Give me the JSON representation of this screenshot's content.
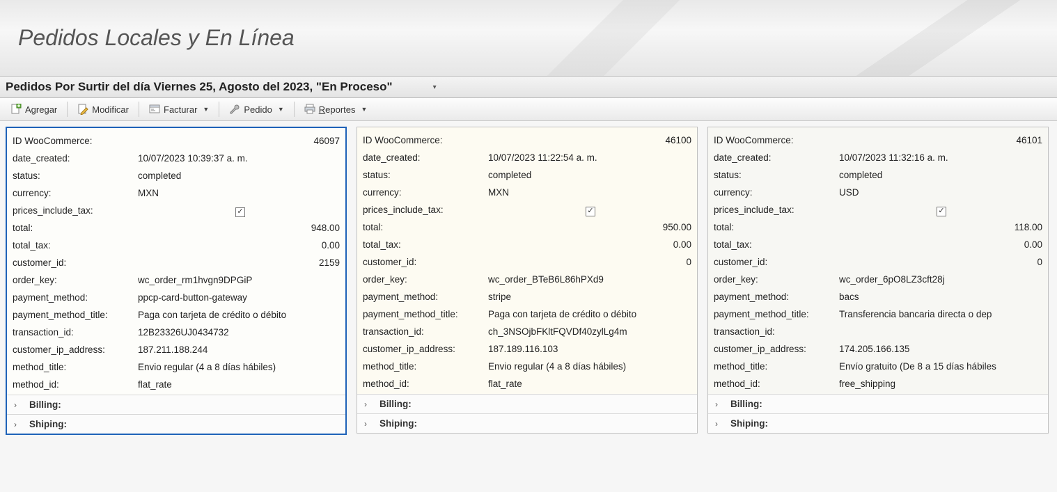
{
  "header": {
    "page_title": "Pedidos Locales y En Línea",
    "sub_title": "Pedidos Por Surtir del día Viernes 25, Agosto del 2023, \"En Proceso\""
  },
  "toolbar": {
    "agregar": "Agregar",
    "modificar": "Modificar",
    "facturar": "Facturar",
    "pedido": "Pedido",
    "reportes": "Reportes"
  },
  "field_labels": {
    "id_woo": "ID WooCommerce:",
    "date_created": "date_created:",
    "status": "status:",
    "currency": "currency:",
    "prices_include_tax": "prices_include_tax:",
    "total": "total:",
    "total_tax": "total_tax:",
    "customer_id": "customer_id:",
    "order_key": "order_key:",
    "payment_method": "payment_method:",
    "payment_method_title": "payment_method_title:",
    "transaction_id": "transaction_id:",
    "customer_ip_address": "customer_ip_address:",
    "method_title": "method_title:",
    "method_id": "method_id:"
  },
  "expanders": {
    "billing": "Billing:",
    "shipping": "Shiping:"
  },
  "orders": [
    {
      "selected": true,
      "id_woo": "46097",
      "date_created": "10/07/2023 10:39:37 a. m.",
      "status": "completed",
      "currency": "MXN",
      "prices_include_tax": true,
      "total": "948.00",
      "total_tax": "0.00",
      "customer_id": "2159",
      "order_key": "wc_order_rm1hvgn9DPGiP",
      "payment_method": "ppcp-card-button-gateway",
      "payment_method_title": "Paga con tarjeta de crédito o débito",
      "transaction_id": "12B23326UJ0434732",
      "customer_ip_address": "187.211.188.244",
      "method_title": "Envio regular (4 a 8 días hábiles)",
      "method_id": "flat_rate"
    },
    {
      "selected": false,
      "id_woo": "46100",
      "date_created": "10/07/2023 11:22:54 a. m.",
      "status": "completed",
      "currency": "MXN",
      "prices_include_tax": true,
      "total": "950.00",
      "total_tax": "0.00",
      "customer_id": "0",
      "order_key": "wc_order_BTeB6L86hPXd9",
      "payment_method": "stripe",
      "payment_method_title": "Paga con tarjeta de crédito o débito",
      "transaction_id": "ch_3NSOjbFKltFQVDf40zylLg4m",
      "customer_ip_address": "187.189.116.103",
      "method_title": "Envio regular (4 a 8 días hábiles)",
      "method_id": "flat_rate"
    },
    {
      "selected": false,
      "id_woo": "46101",
      "date_created": "10/07/2023 11:32:16 a. m.",
      "status": "completed",
      "currency": "USD",
      "prices_include_tax": true,
      "total": "118.00",
      "total_tax": "0.00",
      "customer_id": "0",
      "order_key": "wc_order_6pO8LZ3cft28j",
      "payment_method": "bacs",
      "payment_method_title": "Transferencia bancaria directa o dep",
      "transaction_id": "",
      "customer_ip_address": "174.205.166.135",
      "method_title": "Envío gratuito (De 8 a 15 días hábiles",
      "method_id": "free_shipping"
    }
  ]
}
